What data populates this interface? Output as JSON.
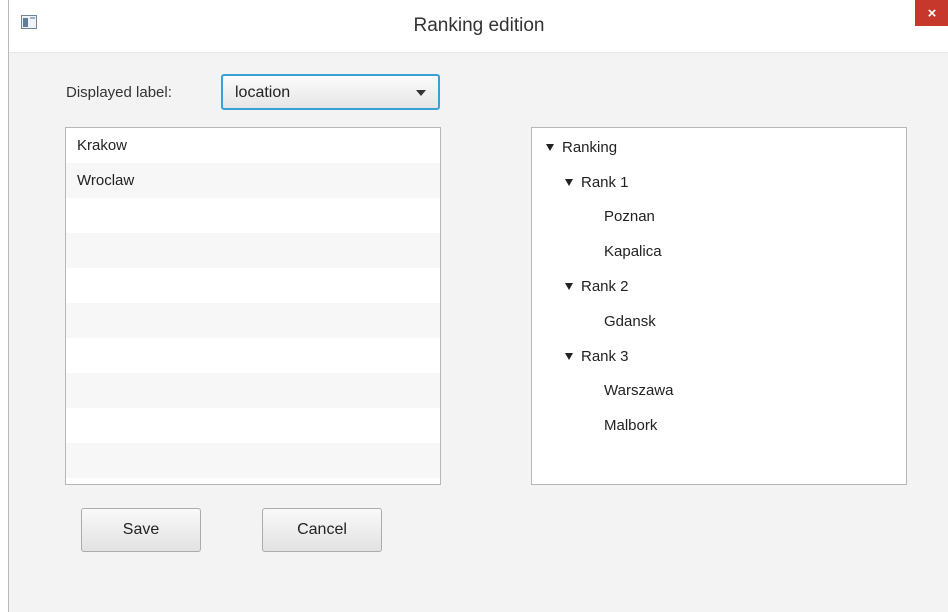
{
  "window": {
    "title": "Ranking edition",
    "close_glyph": "×",
    "app_icon": "window-icon"
  },
  "filter": {
    "label": "Displayed label:",
    "selected": "location"
  },
  "list": {
    "items": [
      "Krakow",
      "Wroclaw"
    ]
  },
  "tree": {
    "nodes": [
      {
        "label": "Ranking",
        "expanded": true,
        "level": 0
      },
      {
        "label": "Rank 1",
        "expanded": true,
        "level": 1
      },
      {
        "label": "Poznan",
        "level": 2
      },
      {
        "label": "Kapalica",
        "level": 2
      },
      {
        "label": "Rank 2",
        "expanded": true,
        "level": 1
      },
      {
        "label": "Gdansk",
        "level": 2
      },
      {
        "label": "Rank 3",
        "expanded": true,
        "level": 1
      },
      {
        "label": "Warszawa",
        "level": 2
      },
      {
        "label": "Malbork",
        "level": 2
      }
    ]
  },
  "buttons": {
    "save": "Save",
    "cancel": "Cancel"
  },
  "colors": {
    "close": "#c7382c",
    "focus_border": "#39a0d8"
  }
}
